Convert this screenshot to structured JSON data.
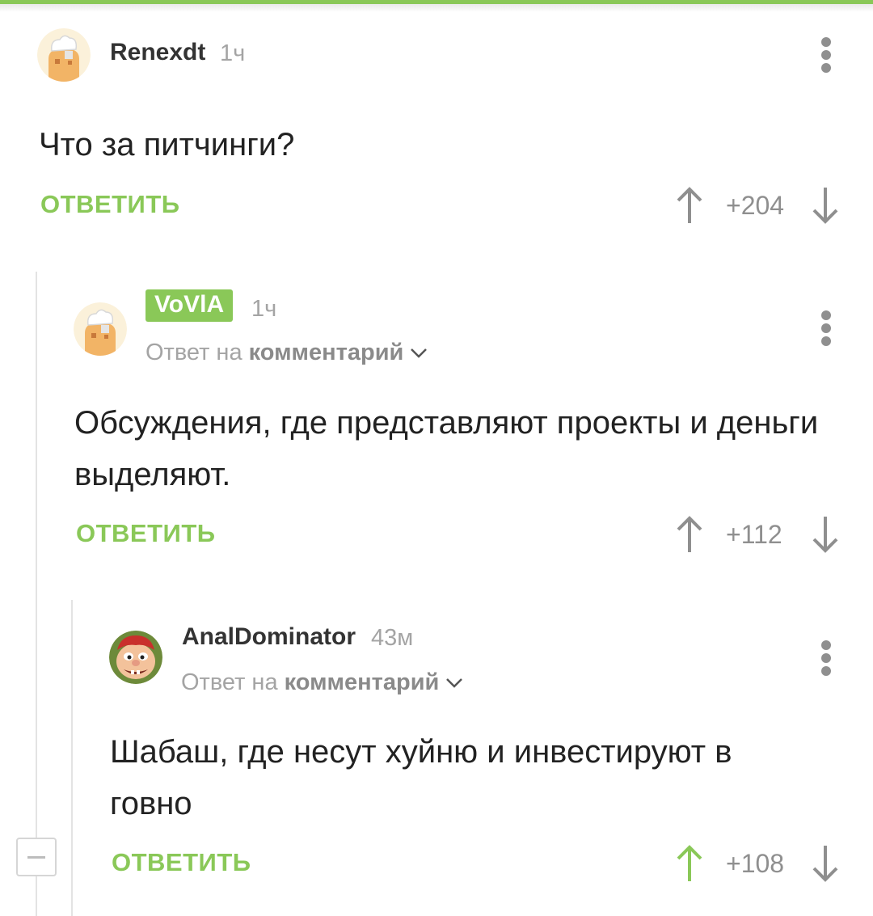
{
  "comments": [
    {
      "username": "Renexdt",
      "time": "1ч",
      "text": "Что за питчинги?",
      "reply_label": "ОТВЕТИТЬ",
      "score": "+204",
      "upvoted": false
    },
    {
      "username": "VoVlA",
      "time": "1ч",
      "reply_to_prefix": "Ответ на",
      "reply_to_link": "комментарий",
      "text": "Обсуждения, где представляют проекты и деньги выделяют.",
      "reply_label": "ОТВЕТИТЬ",
      "score": "+112",
      "upvoted": false,
      "author_badge": true
    },
    {
      "username": "AnalDominator",
      "time": "43м",
      "reply_to_prefix": "Ответ на",
      "reply_to_link": "комментарий",
      "text": "Шабаш, где несут хуйню и инвестируют в говно",
      "reply_label": "ОТВЕТИТЬ",
      "score": "+108",
      "upvoted": true
    }
  ],
  "colors": {
    "accent": "#8ac858",
    "vote_default": "#8f8f8f",
    "vote_active": "#8ac858"
  },
  "icons": [
    "more-vertical-icon",
    "arrow-up-icon",
    "arrow-down-icon",
    "chevron-down-icon",
    "collapse-minus-icon"
  ]
}
